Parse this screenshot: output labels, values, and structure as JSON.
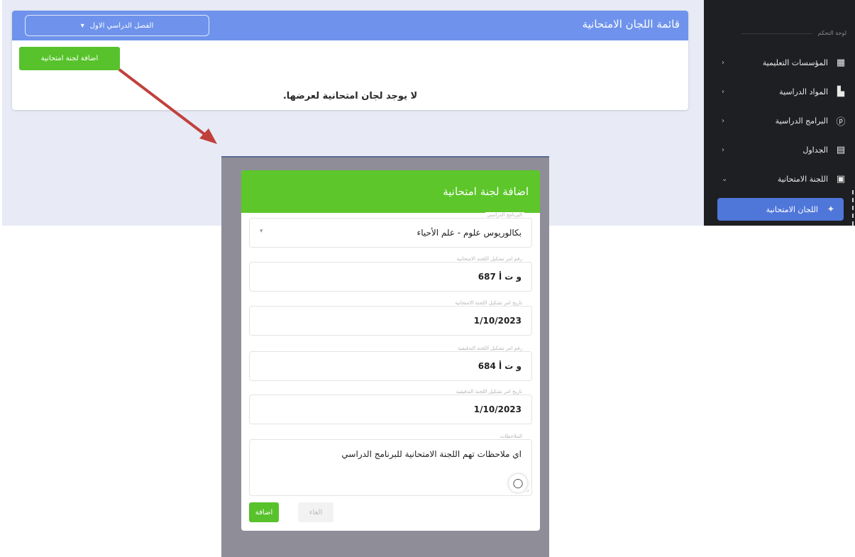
{
  "page": {
    "title": "قائمة اللجان الامتحانية",
    "semester_select": "الفصل الدراسي الاول",
    "add_button": "اضافة لجنة امتحانية",
    "empty_message": "لا يوجد لجان امتحانية لعرضها."
  },
  "sidebar": {
    "section_label": "لوحة التحكم",
    "items": [
      {
        "label": "المؤسسات التعليمية",
        "icon": "building-icon"
      },
      {
        "label": "المواد الدراسية",
        "icon": "books-icon"
      },
      {
        "label": "البرامج الدراسية",
        "icon": "program-icon"
      },
      {
        "label": "الجداول",
        "icon": "table-icon"
      },
      {
        "label": "اللجنة الامتحانية",
        "icon": "committee-icon"
      }
    ],
    "active_item": {
      "label": "اللجان الامتحانية",
      "icon": "tag-icon"
    }
  },
  "modal": {
    "title": "اضافة لجنة امتحانية",
    "fields": [
      {
        "label": "البرنامج الدراسي",
        "value": "بكالوريوس علوم - علم الأحياء"
      },
      {
        "label": "رقم امر تشكيل اللجنة الامتحانية",
        "value": "و ت أ 687"
      },
      {
        "label": "تاريخ امر تشكيل اللجنة الامتحانية",
        "value": "1/10/2023"
      },
      {
        "label": "رقم امر تشكيل اللجنة التدقيقية",
        "value": "و ت أ 684"
      },
      {
        "label": "تاريخ امر تشكيل اللجنة التدقيقية",
        "value": "1/10/2023"
      },
      {
        "label": "الملاحظات",
        "value": "اي ملاحظات تهم اللجنة الامتحانية للبرنامج الدراسي"
      }
    ],
    "submit_label": "اضافة",
    "cancel_label": "الغاء"
  },
  "colors": {
    "header_blue": "#6f93ec",
    "green": "#57c22b",
    "sidebar_bg": "#1e1f22",
    "active_blue": "#4f76d9",
    "arrow": "#c0413c"
  }
}
